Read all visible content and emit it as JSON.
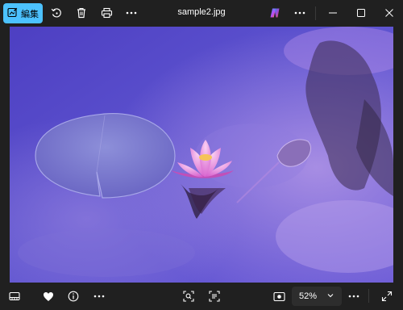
{
  "toolbar": {
    "edit_label": "編集",
    "edit_icon": "edit-image-icon",
    "rotate_icon": "rotate-icon",
    "delete_icon": "trash-icon",
    "print_icon": "printer-icon",
    "more_icon": "more-icon"
  },
  "window": {
    "title": "sample2.jpg",
    "copilot_icon": "copilot-icon",
    "more_icon": "more-icon",
    "minimize_icon": "minimize-icon",
    "maximize_icon": "maximize-icon",
    "close_icon": "close-icon"
  },
  "bottom_bar": {
    "filmstrip_icon": "filmstrip-icon",
    "favorite_icon": "heart-icon",
    "info_icon": "info-icon",
    "more_icon": "more-icon",
    "visual_search_icon": "visual-search-icon",
    "text_scan_icon": "scan-text-icon",
    "fit_icon": "fit-to-window-icon",
    "zoom_value": "52%",
    "zoom_chevron_icon": "chevron-down-icon",
    "fullscreen_icon": "fullscreen-icon"
  },
  "colors": {
    "accent": "#4cc2ff",
    "background": "#202020",
    "water": "#5b50c8",
    "lotus": "#e680d8"
  }
}
